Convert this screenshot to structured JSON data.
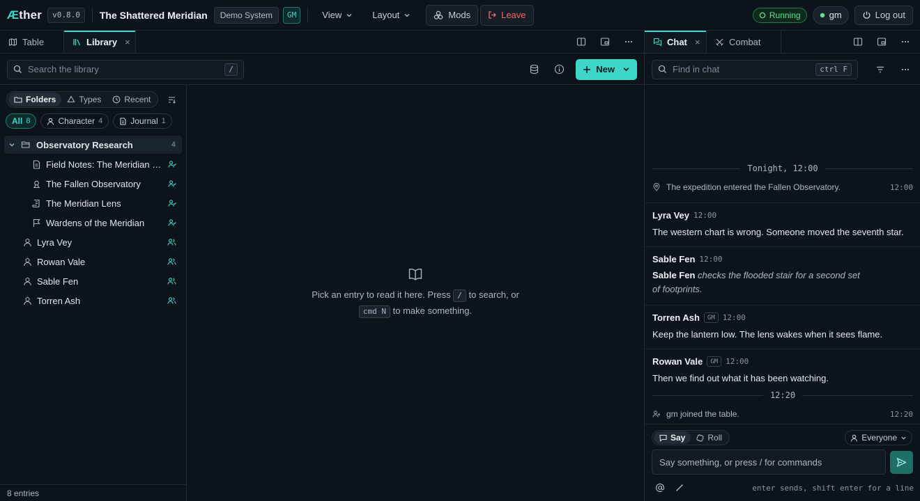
{
  "app": {
    "logo_prefix": "Æ",
    "logo_rest": "ther",
    "version": "v0.8.0",
    "game_title": "The Shattered Meridian",
    "system_badge": "Demo System",
    "gm_badge": "GM"
  },
  "topbar": {
    "view_label": "View",
    "layout_label": "Layout",
    "mods_label": "Mods",
    "leave_label": "Leave",
    "status_label": "Running",
    "user_label": "gm",
    "logout_label": "Log out"
  },
  "left_tabs": [
    {
      "label": "Table"
    },
    {
      "label": "Library",
      "close": "×"
    }
  ],
  "right_tabs": [
    {
      "label": "Chat",
      "close": "×"
    },
    {
      "label": "Combat"
    }
  ],
  "library": {
    "search_placeholder": "Search the library",
    "search_kbd": "/",
    "new_label": "New",
    "view_modes": [
      "Folders",
      "Types",
      "Recent"
    ],
    "filters": [
      {
        "label": "All",
        "count": "8"
      },
      {
        "label": "Character",
        "count": "4"
      },
      {
        "label": "Journal",
        "count": "1"
      }
    ],
    "folder": {
      "label": "Observatory Research",
      "count": "4"
    },
    "folder_items": [
      {
        "label": "Field Notes: The Meridian L..."
      },
      {
        "label": "The Fallen Observatory"
      },
      {
        "label": "The Meridian Lens"
      },
      {
        "label": "Wardens of the Meridian"
      }
    ],
    "root_items": [
      {
        "label": "Lyra Vey"
      },
      {
        "label": "Rowan Vale"
      },
      {
        "label": "Sable Fen"
      },
      {
        "label": "Torren Ash"
      }
    ],
    "entries_label": "8 entries",
    "empty": {
      "line1_a": "Pick an entry to read it here. Press",
      "line1_kbd": "/",
      "line1_b": "to search, or",
      "line2_kbd": "cmd N",
      "line2_b": "to make something."
    }
  },
  "chat": {
    "search_placeholder": "Find in chat",
    "search_kbd": "ctrl F",
    "divider_1": "Tonight, 12:00",
    "system_1": {
      "text": "The expedition entered the Fallen Observatory.",
      "time": "12:00"
    },
    "messages": [
      {
        "name": "Lyra Vey",
        "time": "12:00",
        "text": "The western chart is wrong. Someone moved the seventh star."
      },
      {
        "name": "Sable Fen",
        "time": "12:00",
        "emote_name": "Sable Fen",
        "emote_text": "checks the flooded stair for a second set of footprints."
      },
      {
        "name": "Torren Ash",
        "gm": "GM",
        "time": "12:00",
        "text": "Keep the lantern low. The lens wakes when it sees flame."
      },
      {
        "name": "Rowan Vale",
        "gm": "GM",
        "time": "12:00",
        "text": "Then we find out what it has been watching."
      }
    ],
    "divider_2": "12:20",
    "system_2": {
      "text": "gm joined the table.",
      "time": "12:20"
    },
    "composer": {
      "say_label": "Say",
      "roll_label": "Roll",
      "audience_label": "Everyone",
      "placeholder": "Say something, or press / for commands",
      "hint": "enter sends, shift enter for a line"
    }
  },
  "colors": {
    "accent": "#3dd6c8",
    "danger": "#f06a6a",
    "running": "#5fe08e",
    "background": "#0d131a"
  }
}
